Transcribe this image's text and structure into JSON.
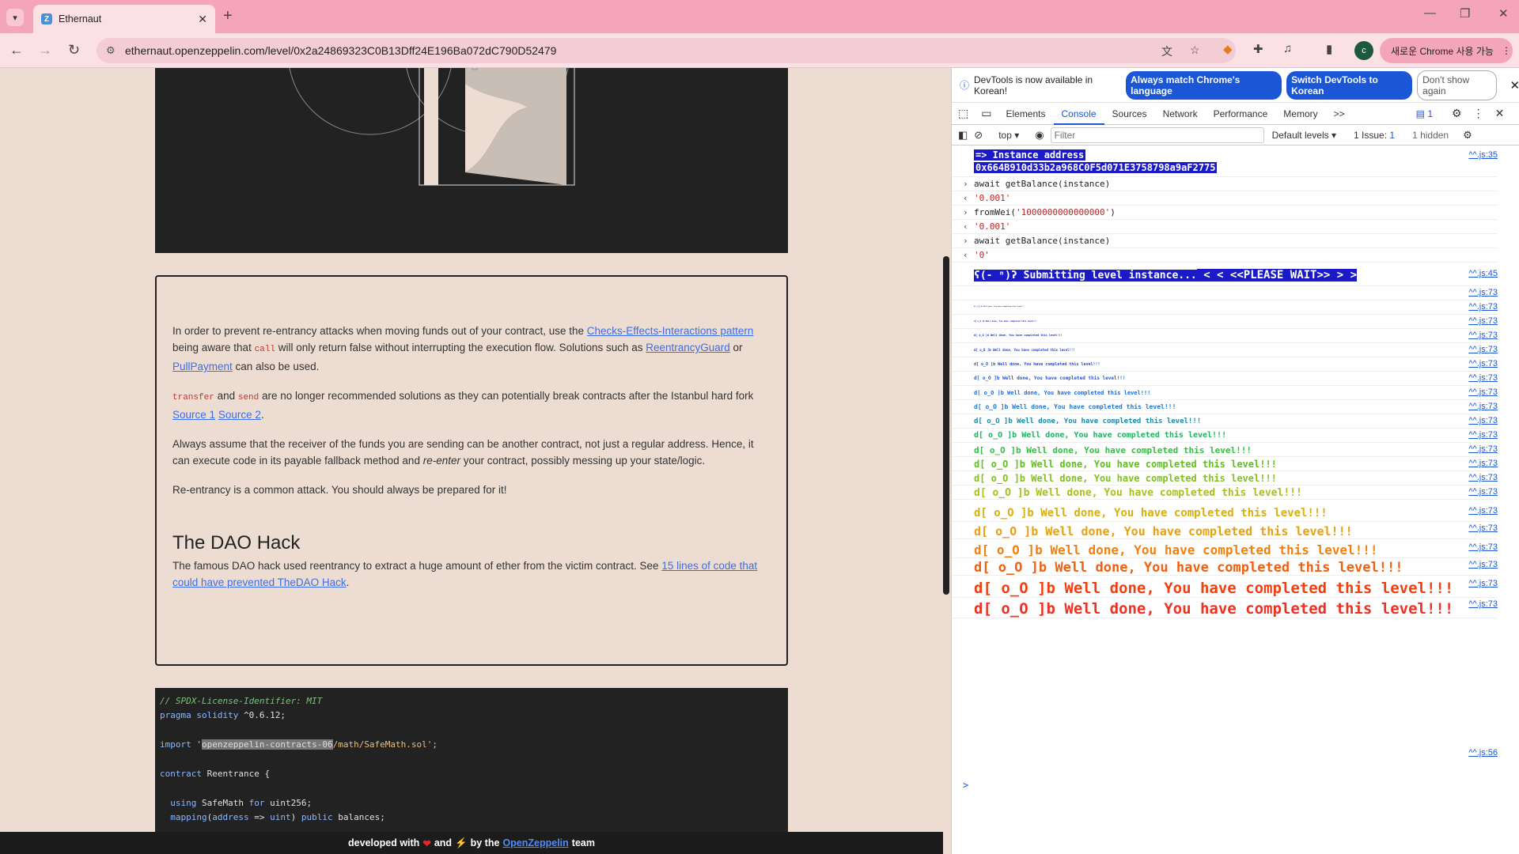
{
  "browser": {
    "tab_title": "Ethernaut",
    "favicon_letter": "Z",
    "url": "ethernaut.openzeppelin.com/level/0x2a24869323C0B13Dff24E196Ba072dC790D52479",
    "chrome_button": "새로운 Chrome 사용 가능",
    "avatar_letter": "c"
  },
  "page": {
    "para1_a": "In order to prevent re-entrancy attacks when moving funds out of your contract, use the ",
    "link_cei": "Checks-Effects-Interactions pattern",
    "para1_b": " being aware that ",
    "code_call": "call",
    "para1_c": " will only return false without interrupting the execution flow. Solutions such as ",
    "link_guard": "ReentrancyGuard",
    "para1_d": " or ",
    "link_pull": "PullPayment",
    "para1_e": " can also be used.",
    "code_transfer": "transfer",
    "para2_a": " and ",
    "code_send": "send",
    "para2_b": " are no longer recommended solutions as they can potentially break contracts after the Istanbul hard fork ",
    "link_source1": "Source 1",
    "link_source2": "Source 2",
    "para2_c": ".",
    "para3_a": "Always assume that the receiver of the funds you are sending can be another contract, not just a regular address. Hence, it can execute code in its payable fallback method and ",
    "para3_em": "re-enter",
    "para3_b": " your contract, possibly messing up your state/logic.",
    "para4": "Re-entrancy is a common attack. You should always be prepared for it!",
    "heading": "The DAO Hack",
    "para5_a": "The famous DAO hack used reentrancy to extract a huge amount of ether from the victim contract. See ",
    "link_dao": "15 lines of code that could have prevented TheDAO Hack",
    "para5_b": ".",
    "code_lines": {
      "l1": "// SPDX-License-Identifier: MIT",
      "l2_kw": "pragma solidity",
      "l2_rest": " ^0.6.12;",
      "l3_kw": "import",
      "l3_q": " '",
      "l3_hl": "openzeppelin-contracts-06",
      "l3_rest": "/math/SafeMath.sol';",
      "l4_kw": "contract",
      "l4_rest": " Reentrance {",
      "l5_kw": "using",
      "l5_a": " SafeMath ",
      "l5_kw2": "for",
      "l5_b": " uint256;",
      "l6_kw": "mapping",
      "l6_a": "(",
      "l6_kw2": "address",
      "l6_b": " => ",
      "l6_kw3": "uint",
      "l6_c": ") ",
      "l6_kw4": "public",
      "l6_d": " balances;"
    },
    "footer_a": "developed with",
    "footer_b": "and",
    "footer_c": "by the",
    "footer_link": "OpenZeppelin",
    "footer_d": "team",
    "heart_icon": "❤",
    "bolt_icon": "⚡"
  },
  "devtools": {
    "info_text": "DevTools is now available in Korean!",
    "btn_match": "Always match Chrome's language",
    "btn_switch": "Switch DevTools to Korean",
    "btn_dont": "Don't show again",
    "tabs": [
      "Elements",
      "Console",
      "Sources",
      "Network",
      "Performance",
      "Memory"
    ],
    "more_tabs": ">>",
    "messages_badge": "1",
    "context": "top",
    "filter_placeholder": "Filter",
    "levels": "Default levels",
    "issues_label": "1 Issue:",
    "issues_count": "1",
    "hidden": "1 hidden",
    "console": {
      "instance_label": "=> Instance address",
      "instance_addr": "0x664B910d33b2a968C0F5d071E3758798a9aF2775",
      "src35": "^^.js:35",
      "cmd1": "await getBalance(instance)",
      "res1": "'0.001'",
      "cmd2_a": "fromWei(",
      "cmd2_b": "'1000000000000000'",
      "cmd2_c": ")",
      "res2": "'0.001'",
      "cmd3": "await getBalance(instance)",
      "res3": "'0'",
      "submitting": "ʕ(- ⁿ)ʔ Submitting level instance...",
      "please_wait": " <  < <<PLEASE WAIT>> >  > ",
      "src45": "^^.js:45",
      "src73": "^^.js:73",
      "src56": "^^.js:56",
      "well_done": "d[ o_O ]b Well done, You have completed this level!!!",
      "prompt": ">"
    }
  },
  "colors": {
    "tabbar": "#f4a5b8",
    "page_bg": "#eddcd2",
    "accent": "#1a56d6"
  }
}
